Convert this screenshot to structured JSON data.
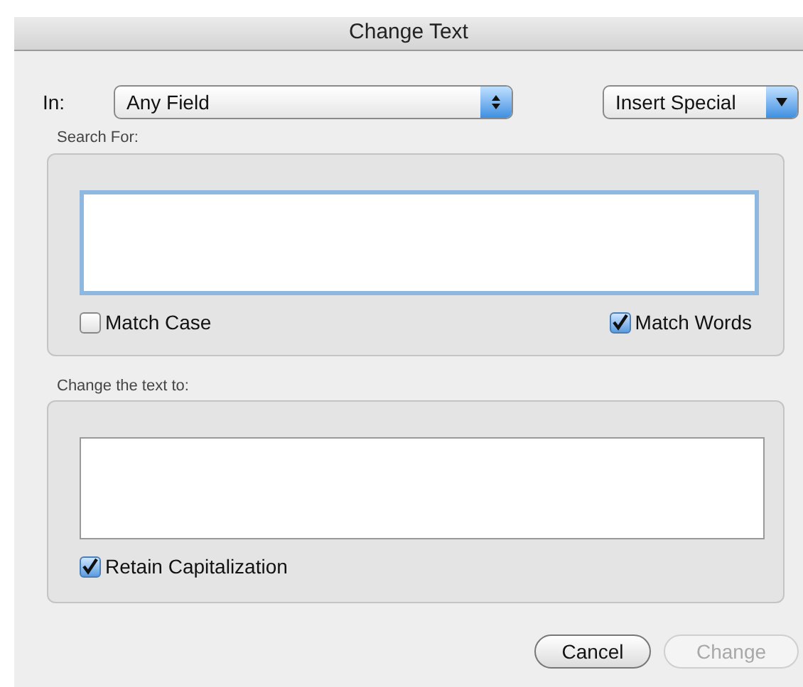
{
  "window": {
    "title": "Change Text"
  },
  "scope": {
    "label": "In:",
    "value": "Any Field"
  },
  "insert_special": {
    "label": "Insert Special"
  },
  "search_group": {
    "label": "Search For:",
    "field": {
      "focused": true
    },
    "options": [
      {
        "label": "Match Case",
        "checked": false
      },
      {
        "label": "Match Words",
        "checked": true
      }
    ]
  },
  "replace_group": {
    "label": "Change the text to:",
    "field": {
      "focused": false
    },
    "options": [
      {
        "label": "Retain Capitalization",
        "checked": true
      }
    ]
  },
  "buttons": [
    {
      "label": "Cancel",
      "disabled": false
    },
    {
      "label": "Change",
      "disabled": true
    }
  ]
}
